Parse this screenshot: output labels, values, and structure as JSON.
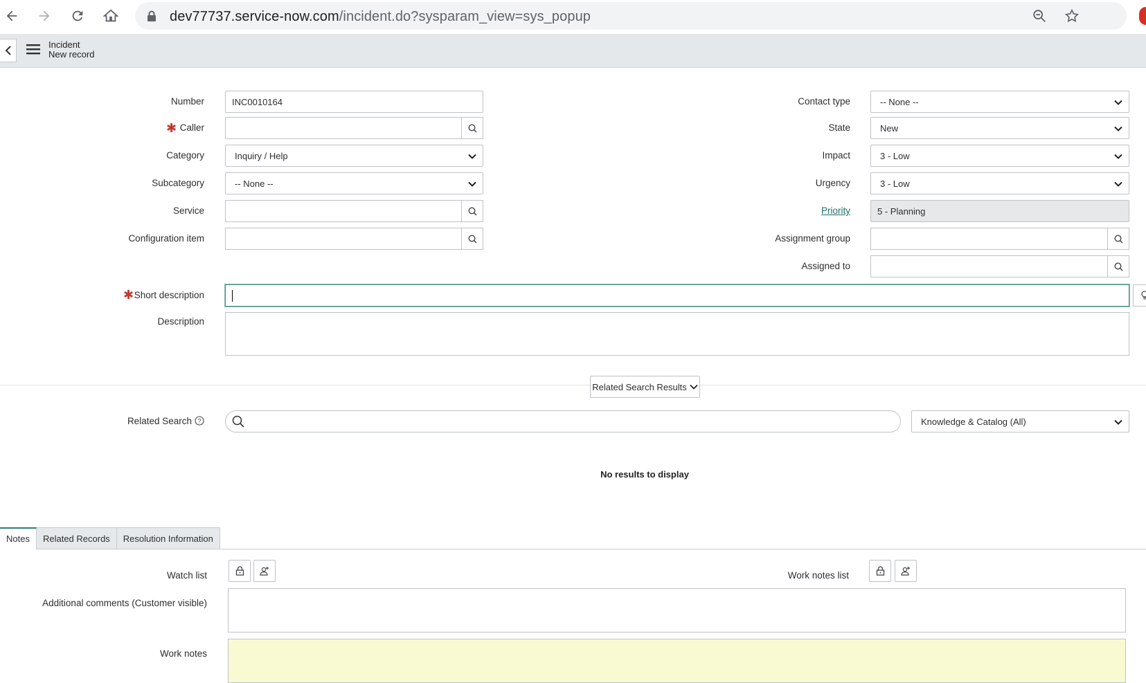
{
  "browser": {
    "url_domain": "dev77737.service-now.com",
    "url_path": "/incident.do?sysparam_view=sys_popup"
  },
  "header": {
    "title": "Incident",
    "subtitle": "New record"
  },
  "form": {
    "number": {
      "label": "Number",
      "value": "INC0010164"
    },
    "caller": {
      "label": "Caller",
      "value": ""
    },
    "category": {
      "label": "Category",
      "value": "Inquiry / Help"
    },
    "subcategory": {
      "label": "Subcategory",
      "value": "-- None --"
    },
    "service": {
      "label": "Service",
      "value": ""
    },
    "config_item": {
      "label": "Configuration item",
      "value": ""
    },
    "contact_type": {
      "label": "Contact type",
      "value": "-- None --"
    },
    "state": {
      "label": "State",
      "value": "New"
    },
    "impact": {
      "label": "Impact",
      "value": "3 - Low"
    },
    "urgency": {
      "label": "Urgency",
      "value": "3 - Low"
    },
    "priority": {
      "label": "Priority",
      "value": "5 - Planning"
    },
    "assignment_group": {
      "label": "Assignment group",
      "value": ""
    },
    "assigned_to": {
      "label": "Assigned to",
      "value": ""
    },
    "short_description": {
      "label": "Short description",
      "value": ""
    },
    "description": {
      "label": "Description",
      "value": ""
    }
  },
  "related_search": {
    "toggle_label": "Related Search Results",
    "label": "Related Search",
    "scope": "Knowledge & Catalog (All)",
    "no_results": "No results to display"
  },
  "tabs": [
    "Notes",
    "Related Records",
    "Resolution Information"
  ],
  "notes": {
    "watch_list_label": "Watch list",
    "work_notes_list_label": "Work notes list",
    "additional_comments_label": "Additional comments (Customer visible)",
    "work_notes_label": "Work notes"
  },
  "colors": {
    "required": "#c23934",
    "accent": "#2f7b73",
    "work_notes_bg": "#fafad2"
  }
}
